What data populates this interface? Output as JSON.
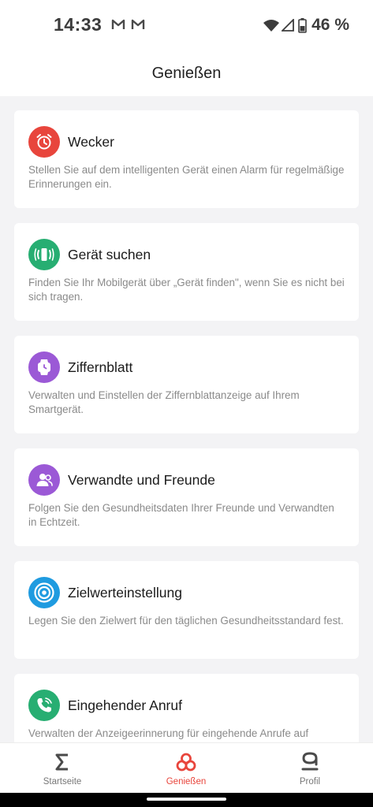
{
  "status_bar": {
    "time": "14:33",
    "battery_percent": "46 %",
    "notification_icons": [
      "gmail-icon",
      "gmail-icon"
    ],
    "system_icons": [
      "wifi-icon",
      "signal-icon",
      "battery-icon"
    ]
  },
  "header": {
    "title": "Genießen"
  },
  "cards": [
    {
      "title": "Wecker",
      "description": "Stellen Sie auf dem intelligenten Gerät einen Alarm für regelmäßige Erinnerungen ein.",
      "icon": "alarm-clock-icon",
      "color": "#e8453c"
    },
    {
      "title": "Gerät suchen",
      "description": "Finden Sie Ihr Mobilgerät über „Gerät finden\", wenn Sie es nicht bei sich tragen.",
      "icon": "find-device-icon",
      "color": "#27ae72"
    },
    {
      "title": "Ziffernblatt",
      "description": "Verwalten und Einstellen der Ziffernblattanzeige auf Ihrem Smartgerät.",
      "icon": "watch-face-icon",
      "color": "#9b59d6"
    },
    {
      "title": "Verwandte und Freunde",
      "description": "Folgen Sie den Gesundheitsdaten Ihrer Freunde und Verwandten in Echtzeit.",
      "icon": "friends-icon",
      "color": "#9b59d6"
    },
    {
      "title": "Zielwerteinstellung",
      "description": "Legen Sie den Zielwert für den täglichen Gesundheitsstandard fest.",
      "icon": "target-icon",
      "color": "#1f9be0"
    },
    {
      "title": "Eingehender Anruf",
      "description": "Verwalten der Anzeigeerinnerung für eingehende Anrufe auf",
      "icon": "incoming-call-icon",
      "color": "#27ae72"
    }
  ],
  "bottom_nav": {
    "items": [
      {
        "label": "Startseite",
        "icon": "sigma-icon",
        "active": false
      },
      {
        "label": "Genießen",
        "icon": "enjoy-icon",
        "active": true
      },
      {
        "label": "Profil",
        "icon": "profile-icon",
        "active": false
      }
    ],
    "active_color": "#e8453c"
  }
}
